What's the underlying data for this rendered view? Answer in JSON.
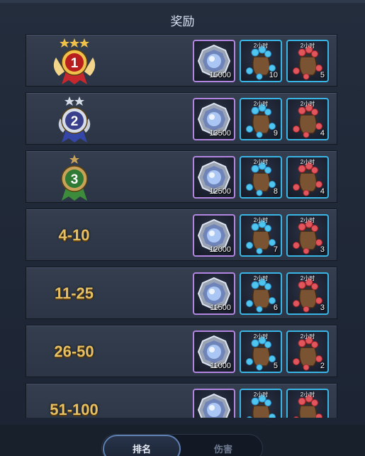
{
  "title": "奖励",
  "rows": [
    {
      "rank_label": "",
      "medal": "gold-medal-1",
      "gem": "15000",
      "bag_time_1": "2小时",
      "bag_count_1": "10",
      "bag_time_2": "2小时",
      "bag_count_2": "5"
    },
    {
      "rank_label": "",
      "medal": "silver-medal-2",
      "gem": "13500",
      "bag_time_1": "2小时",
      "bag_count_1": "9",
      "bag_time_2": "2小时",
      "bag_count_2": "4"
    },
    {
      "rank_label": "",
      "medal": "bronze-medal-3",
      "gem": "12500",
      "bag_time_1": "2小时",
      "bag_count_1": "8",
      "bag_time_2": "2小时",
      "bag_count_2": "4"
    },
    {
      "rank_label": "4-10",
      "gem": "12000",
      "bag_time_1": "2小时",
      "bag_count_1": "7",
      "bag_time_2": "2小时",
      "bag_count_2": "3"
    },
    {
      "rank_label": "11-25",
      "gem": "11500",
      "bag_time_1": "2小时",
      "bag_count_1": "6",
      "bag_time_2": "2小时",
      "bag_count_2": "3"
    },
    {
      "rank_label": "26-50",
      "gem": "11000",
      "bag_time_1": "2小时",
      "bag_count_1": "5",
      "bag_time_2": "2小时",
      "bag_count_2": "2"
    },
    {
      "rank_label": "51-100",
      "gem": "",
      "bag_time_1": "2小时",
      "bag_count_1": "",
      "bag_time_2": "2小时",
      "bag_count_2": ""
    }
  ],
  "tabs": {
    "ranking": "排名",
    "damage": "伤害"
  },
  "colors": {
    "gold": "#e6c063",
    "gem_border": "#b285e0",
    "bag_border": "#39b6e6",
    "panel": "#232d3c"
  },
  "icons": {
    "gem": "crystal-gem-icon",
    "blue_bag": "blue-gem-bag-icon",
    "red_bag": "red-gem-bag-icon"
  }
}
